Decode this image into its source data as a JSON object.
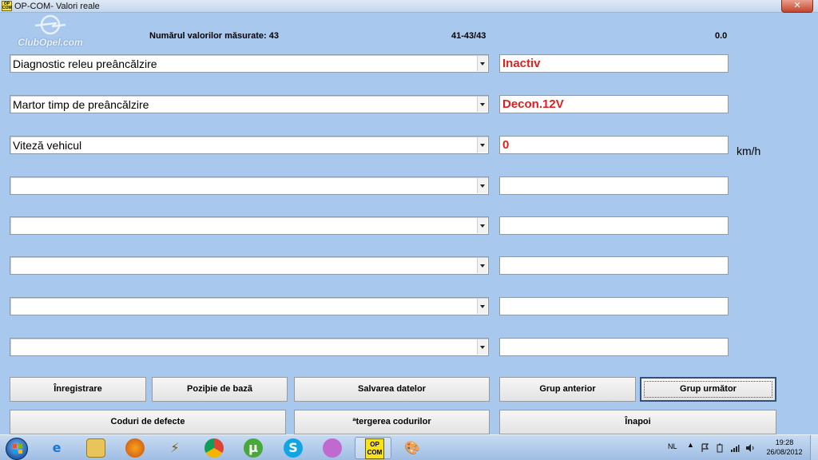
{
  "window": {
    "title": "OP-COM- Valori reale",
    "icon_label": "OP COM",
    "close_label": "✕"
  },
  "header": {
    "logo_text": "ClubOpel.com",
    "measured_count": "Numărul valorilor măsurate: 43",
    "range": "41-43/43",
    "value": "0.0"
  },
  "rows": [
    {
      "label": "Diagnostic releu preâncălzire",
      "value": "Inactiv",
      "unit": ""
    },
    {
      "label": "Martor timp de preâncălzire",
      "value": "Decon.12V",
      "unit": ""
    },
    {
      "label": "Viteză vehicul",
      "value": "0",
      "unit": "km/h"
    },
    {
      "label": "",
      "value": "",
      "unit": ""
    },
    {
      "label": "",
      "value": "",
      "unit": ""
    },
    {
      "label": "",
      "value": "",
      "unit": ""
    },
    {
      "label": "",
      "value": "",
      "unit": ""
    },
    {
      "label": "",
      "value": "",
      "unit": ""
    }
  ],
  "buttons": {
    "record": "Înregistrare",
    "base_position": "Poziþie de bazã",
    "save_data": "Salvarea datelor",
    "prev_group": "Grup anterior",
    "next_group": "Grup următor",
    "fault_codes": "Coduri de defecte",
    "clear_codes": "ªtergerea codurilor",
    "back": "Înapoi"
  },
  "taskbar": {
    "apps": [
      "start-icon",
      "internet-explorer-icon",
      "file-explorer-icon",
      "firefox-icon",
      "tool-icon",
      "chrome-icon",
      "utorrent-icon",
      "skype-icon",
      "paint-icon",
      "opcom-icon",
      "palette-icon"
    ],
    "opcom_label": "OP COM",
    "language": "NL",
    "time": "19:28",
    "date": "26/08/2012"
  },
  "colors": {
    "background": "#a9c8ee",
    "value_text": "#e02020"
  }
}
